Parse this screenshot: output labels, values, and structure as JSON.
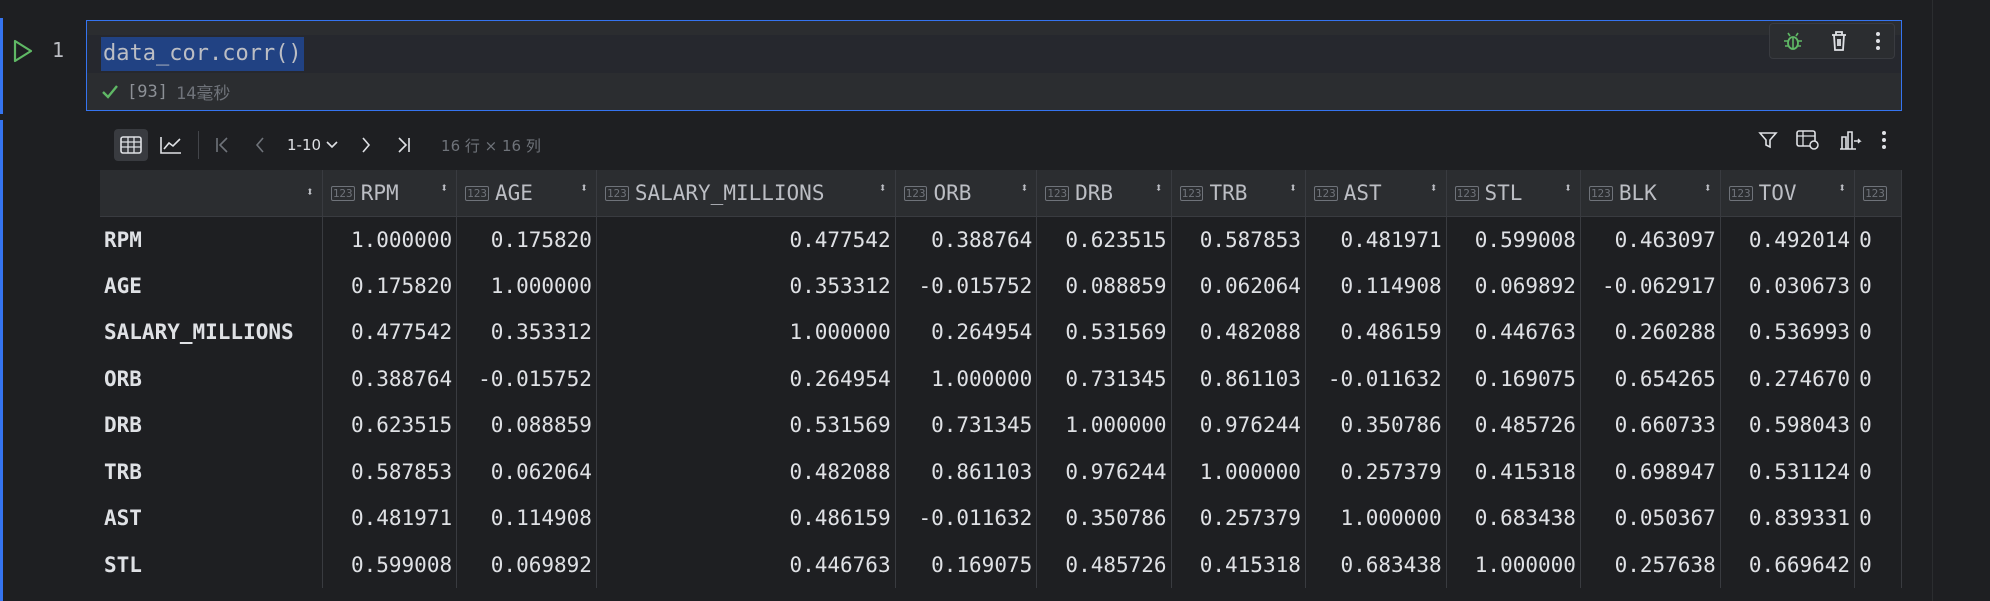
{
  "editor": {
    "line_number": "1",
    "code": "data_cor.corr()",
    "exec_count": "[93]",
    "exec_time": "14毫秒"
  },
  "output": {
    "pager": "1-10",
    "shape": "16 行 × 16 列",
    "columns": [
      "RPM",
      "AGE",
      "SALARY_MILLIONS",
      "ORB",
      "DRB",
      "TRB",
      "AST",
      "STL",
      "BLK",
      "TOV",
      ""
    ],
    "rows": [
      {
        "label": "RPM",
        "cells": [
          "1.000000",
          "0.175820",
          "0.477542",
          "0.388764",
          "0.623515",
          "0.587853",
          "0.481971",
          "0.599008",
          "0.463097",
          "0.492014",
          "0"
        ]
      },
      {
        "label": "AGE",
        "cells": [
          "0.175820",
          "1.000000",
          "0.353312",
          "-0.015752",
          "0.088859",
          "0.062064",
          "0.114908",
          "0.069892",
          "-0.062917",
          "0.030673",
          "0"
        ]
      },
      {
        "label": "SALARY_MILLIONS",
        "cells": [
          "0.477542",
          "0.353312",
          "1.000000",
          "0.264954",
          "0.531569",
          "0.482088",
          "0.486159",
          "0.446763",
          "0.260288",
          "0.536993",
          "0"
        ]
      },
      {
        "label": "ORB",
        "cells": [
          "0.388764",
          "-0.015752",
          "0.264954",
          "1.000000",
          "0.731345",
          "0.861103",
          "-0.011632",
          "0.169075",
          "0.654265",
          "0.274670",
          "0"
        ]
      },
      {
        "label": "DRB",
        "cells": [
          "0.623515",
          "0.088859",
          "0.531569",
          "0.731345",
          "1.000000",
          "0.976244",
          "0.350786",
          "0.485726",
          "0.660733",
          "0.598043",
          "0"
        ]
      },
      {
        "label": "TRB",
        "cells": [
          "0.587853",
          "0.062064",
          "0.482088",
          "0.861103",
          "0.976244",
          "1.000000",
          "0.257379",
          "0.415318",
          "0.698947",
          "0.531124",
          "0"
        ]
      },
      {
        "label": "AST",
        "cells": [
          "0.481971",
          "0.114908",
          "0.486159",
          "-0.011632",
          "0.350786",
          "0.257379",
          "1.000000",
          "0.683438",
          "0.050367",
          "0.839331",
          "0"
        ]
      },
      {
        "label": "STL",
        "cells": [
          "0.599008",
          "0.069892",
          "0.446763",
          "0.169075",
          "0.485726",
          "0.415318",
          "0.683438",
          "1.000000",
          "0.257638",
          "0.669642",
          "0"
        ]
      }
    ]
  },
  "colors": {
    "accent": "#3574f0",
    "success": "#5fb865",
    "selection": "#214283"
  }
}
